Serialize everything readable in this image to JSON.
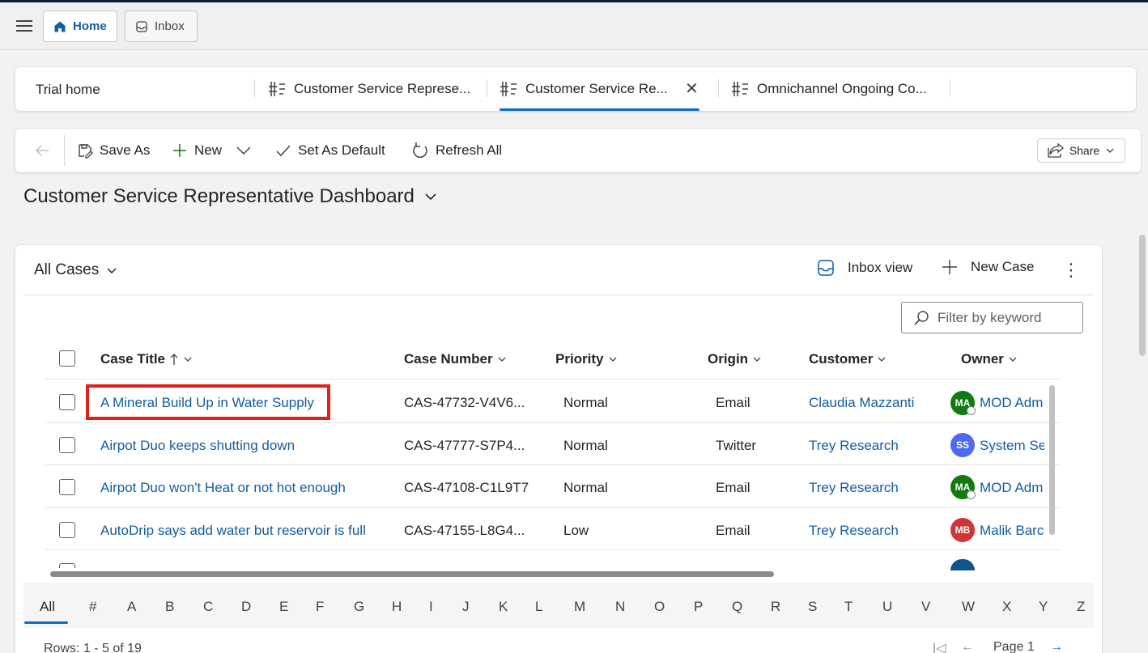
{
  "app_header": {
    "tabs": [
      {
        "label": "Home",
        "icon": "home-icon"
      },
      {
        "label": "Inbox",
        "icon": "inbox-icon"
      }
    ]
  },
  "session_tabs": {
    "home": "Trial home",
    "tabs": [
      {
        "label": "Customer Service Represe...",
        "icon": "dashboard-icon"
      },
      {
        "label": "Customer Service Re...",
        "icon": "dashboard-icon",
        "active": true
      },
      {
        "label": "Omnichannel Ongoing Co...",
        "icon": "dashboard-icon"
      }
    ]
  },
  "command_bar": {
    "save_as": "Save As",
    "new": "New",
    "set_default": "Set As Default",
    "refresh_all": "Refresh All",
    "share": "Share"
  },
  "page": {
    "title": "Customer Service Representative Dashboard"
  },
  "grid": {
    "view_title": "All Cases",
    "inbox_view": "Inbox view",
    "new_case": "New Case",
    "filter_placeholder": "Filter by keyword",
    "columns": [
      "Case Title",
      "Case Number",
      "Priority",
      "Origin",
      "Customer",
      "Owner"
    ],
    "rows": [
      {
        "title": "A Mineral Build Up in Water Supply",
        "number": "CAS-47732-V4V6...",
        "priority": "Normal",
        "origin": "Email",
        "customer": "Claudia Mazzanti",
        "owner_initials": "MA",
        "owner": "MOD Adm",
        "avatar_color": "#107c10"
      },
      {
        "title": "Airpot Duo keeps shutting down",
        "number": "CAS-47777-S7P4...",
        "priority": "Normal",
        "origin": "Twitter",
        "customer": "Trey Research",
        "owner_initials": "SS",
        "owner": "System Se",
        "avatar_color": "#4f6bed"
      },
      {
        "title": "Airpot Duo won't Heat or not hot enough",
        "number": "CAS-47108-C1L9T7",
        "priority": "Normal",
        "origin": "Email",
        "customer": "Trey Research",
        "owner_initials": "MA",
        "owner": "MOD Adm",
        "avatar_color": "#107c10"
      },
      {
        "title": "AutoDrip says add water but reservoir is full",
        "number": "CAS-47155-L8G4...",
        "priority": "Low",
        "origin": "Email",
        "customer": "Trey Research",
        "owner_initials": "MB",
        "owner": "Malik Barc",
        "avatar_color": "#d13438"
      }
    ],
    "alphabet": [
      "All",
      "#",
      "A",
      "B",
      "C",
      "D",
      "E",
      "F",
      "G",
      "H",
      "I",
      "J",
      "K",
      "L",
      "M",
      "N",
      "O",
      "P",
      "Q",
      "R",
      "S",
      "T",
      "U",
      "V",
      "W",
      "X",
      "Y",
      "Z"
    ],
    "rows_text": "Rows: 1 - 5 of 19",
    "page_text": "Page 1"
  },
  "colors": {
    "accent": "#0f6cbd",
    "link": "#115ea3",
    "highlight": "#e0201b"
  }
}
